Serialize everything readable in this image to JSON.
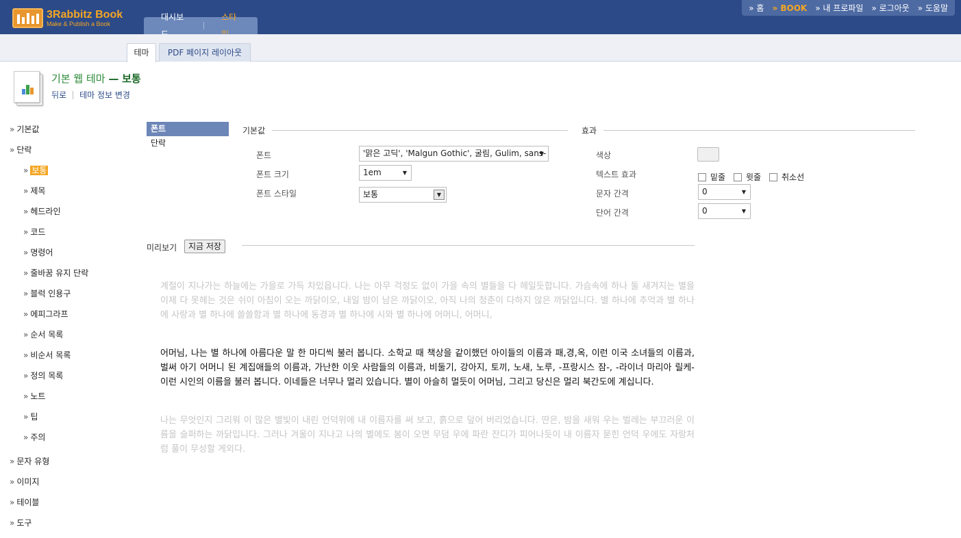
{
  "header": {
    "logo_title": "3Rabbitz Book",
    "logo_subtitle": "Make & Publish a Book",
    "main_tabs": [
      {
        "label": "대시보드",
        "active": false
      },
      {
        "label": "스타일",
        "active": true
      }
    ],
    "top_links": [
      {
        "label": "» 홈",
        "active": false
      },
      {
        "label": "» BOOK",
        "active": true
      },
      {
        "label": "» 내 프로파일",
        "active": false
      },
      {
        "label": "» 로그아웃",
        "active": false
      },
      {
        "label": "» 도움말",
        "active": false
      }
    ]
  },
  "subtabs": [
    {
      "label": "테마",
      "active": true
    },
    {
      "label": "PDF 페이지 레이아웃",
      "active": false
    }
  ],
  "page": {
    "title_prefix": "기본 웹 테마",
    "title_dash": "—",
    "title_suffix": "보통",
    "back_link": "뒤로",
    "edit_link": "테마 정보 변경"
  },
  "leftnav": {
    "items": [
      {
        "label": "기본값",
        "level": 0
      },
      {
        "label": "단락",
        "level": 0
      },
      {
        "label": "보통",
        "level": 1,
        "selected": true
      },
      {
        "label": "제목",
        "level": 1
      },
      {
        "label": "헤드라인",
        "level": 1
      },
      {
        "label": "코드",
        "level": 1
      },
      {
        "label": "명령어",
        "level": 1
      },
      {
        "label": "줄바꿈 유지 단락",
        "level": 1
      },
      {
        "label": "블럭 인용구",
        "level": 1
      },
      {
        "label": "에피그라프",
        "level": 1
      },
      {
        "label": "순서 목록",
        "level": 1
      },
      {
        "label": "비순서 목록",
        "level": 1
      },
      {
        "label": "정의 목록",
        "level": 1
      },
      {
        "label": "노트",
        "level": 1
      },
      {
        "label": "팁",
        "level": 1
      },
      {
        "label": "주의",
        "level": 1
      },
      {
        "label": "문자 유형",
        "level": 0
      },
      {
        "label": "이미지",
        "level": 0
      },
      {
        "label": "테이블",
        "level": 0
      },
      {
        "label": "도구",
        "level": 0
      }
    ]
  },
  "panel_tabs": [
    {
      "label": "폰트",
      "active": true
    },
    {
      "label": "단락",
      "active": false
    }
  ],
  "defaults_section": {
    "heading": "기본값",
    "font_label": "폰트",
    "font_value": "'맑은 고딕', 'Malgun Gothic', 굴림, Gulim, sans-",
    "size_label": "폰트 크기",
    "size_value": "1em",
    "style_label": "폰트 스타일",
    "style_value": "보통"
  },
  "effects_section": {
    "heading": "효과",
    "color_label": "색상",
    "color_value": "#f0f0f0",
    "text_effect_label": "텍스트 효과",
    "underline_label": "밑줄",
    "overline_label": "윗줄",
    "strike_label": "취소선",
    "letter_spacing_label": "문자 간격",
    "letter_spacing_value": "0",
    "word_spacing_label": "단어 간격",
    "word_spacing_value": "0"
  },
  "preview": {
    "heading": "미리보기",
    "save_label": "지금 저장",
    "para1": "계절이 지나가는 하늘에는 가을로 가득 차있읍니다. 나는 아무 걱정도 없이 가을 속의 별들을 다 헤일듯합니다. 가슴속에 하나 둘 새겨지는 별을 이제 다 못헤는 것은 쉬이 아침이 오는 까닭이오, 내일 밤이 남은 까닭이오, 아직 나의 청춘이 다하지 않은 까닭입니다. 별 하나에 추억과 별 하나에 사랑과 별 하나에 쓸쓸함과 별 하나에 동경과 별 하나에 시와 별 하나에 어머니, 어머니,",
    "para2": "어머님, 나는 별 하나에 아름다운 말 한 마디씩 불러 봅니다. 소학교 때 책상을 같이했던 아이들의 이름과 패,경,옥, 이런 이국 소녀들의 이름과, 벌써 아기 어머니 된 계집애들의 이름과, 가난한 이웃 사람들의 이름과, 비둘기, 강아지, 토끼, 노새, 노루, -프랑시스 잠-, -라이너 마리아 릴케- 이런 시인의 이름을 불러 봅니다. 이네들은 너무나 멀리 있습니다. 별이 아슬히 멀듯이 어머님, 그리고 당신은 멀리 북간도에 계십니다.",
    "para3": "나는 무엇인지 그리워 이 많은 별빛이 내린 언덕위에 내 이름자를 써 보고, 흙으로 덮어 버리었습니다. 딴은, 밤을 새워 우는 벌레는 부끄러운 이름을 슬퍼하는 까닭입니다. 그러나 겨울이 지나고 나의 별에도 봄이 오면 무덤 우에 파란 잔디가 피어나듯이 내 이름자 묻힌 언덕 우에도 자랑처럼 풀이 무성할 게외다."
  }
}
